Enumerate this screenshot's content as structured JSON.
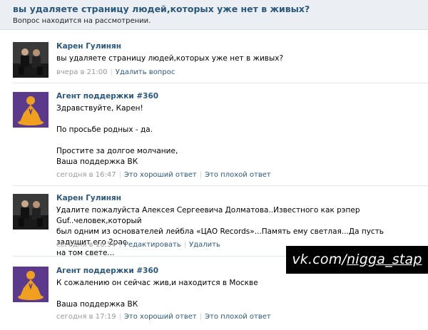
{
  "question": {
    "title": "вы удаляете страницу людей,которых уже нет в живых?",
    "status": "Вопрос находится на рассмотрении."
  },
  "messages": [
    {
      "author": "Карен Гулинян",
      "lines": [
        "вы удаляете страницу людей,которых уже нет в живых?"
      ],
      "time": "вчера в 21:00",
      "actions": [
        "Удалить вопрос"
      ]
    },
    {
      "author": "Агент поддержки #360",
      "lines": [
        "Здравствуйте, Карен!",
        "",
        "По просьбе родных - да.",
        "",
        "Простите за долгое молчание,",
        "Ваша поддержка ВК"
      ],
      "time": "сегодня в 16:47",
      "actions": [
        "Это хороший ответ",
        "Это плохой ответ"
      ]
    },
    {
      "author": "Карен Гулинян",
      "lines": [
        "Удалите пожалуйста Алексея Сергеевича Долматова..Известного как рэпер Guf..человек,который",
        "был одним из основателей лейбла «ЦАО Records»...Память ему светлая...Да пусть задушит его 2рас",
        "на том свете..."
      ],
      "time": "сегодня в 16:54",
      "actions": [
        "Редактировать",
        "Удалить"
      ]
    },
    {
      "author": "Агент поддержки #360",
      "lines": [
        "К сожалению он сейчас жив,и находится в Москве",
        "",
        "Ваша поддержка ВК"
      ],
      "time": "сегодня в 17:19",
      "actions": [
        "Это хороший ответ",
        "Это плохой ответ"
      ]
    }
  ],
  "watermark": {
    "site": "vk.com/",
    "handle": "nigga_stap"
  },
  "colors": {
    "link": "#2b587a",
    "meta": "#999999",
    "topbar": "#ebeff3",
    "agent_avatar_bg": "#5b3a8b",
    "agent_avatar_figure": "#f0a020"
  }
}
